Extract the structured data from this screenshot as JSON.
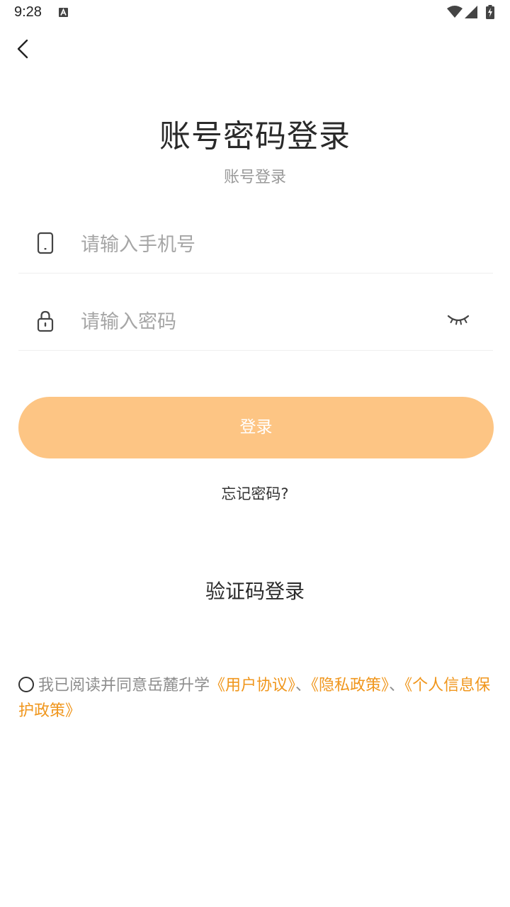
{
  "status_bar": {
    "time": "9:28"
  },
  "header": {
    "title": "账号密码登录",
    "subtitle": "账号登录"
  },
  "form": {
    "phone_placeholder": "请输入手机号",
    "password_placeholder": "请输入密码",
    "login_label": "登录",
    "forgot_label": "忘记密码?",
    "sms_login_label": "验证码登录"
  },
  "agreement": {
    "prefix": "我已阅读并同意岳麓升学",
    "user_agreement": "《用户协议》",
    "separator1": "、",
    "privacy_policy": "《隐私政策》",
    "separator2": "、",
    "personal_info_policy": "《个人信息保护政策》"
  },
  "colors": {
    "accent": "#fdc584",
    "link": "#f0961c"
  }
}
